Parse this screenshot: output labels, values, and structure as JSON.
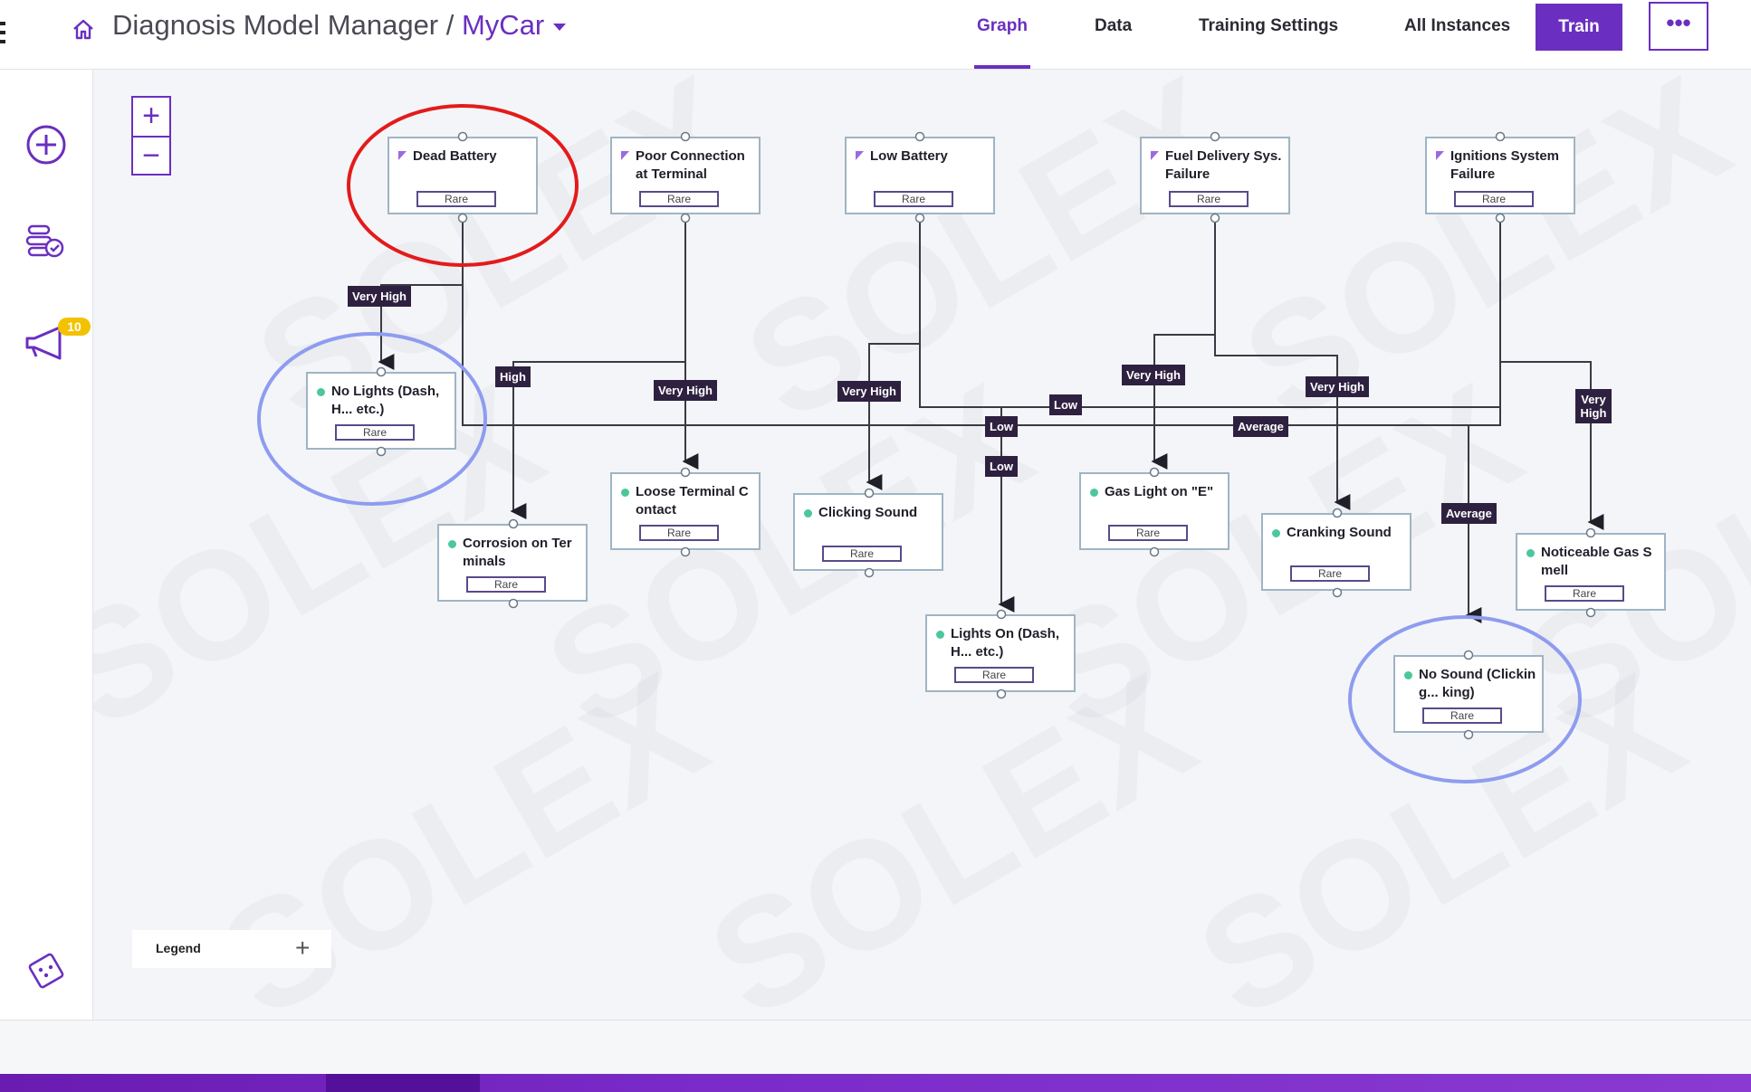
{
  "header": {
    "breadcrumb_root": "Diagnosis Model Manager /",
    "project": "MyCar",
    "tabs": [
      {
        "label": "Graph",
        "active": true
      },
      {
        "label": "Data",
        "active": false
      },
      {
        "label": "Training Settings",
        "active": false
      },
      {
        "label": "All Instances",
        "active": false
      }
    ],
    "train_label": "Train",
    "more_label": "•••"
  },
  "sidebar": {
    "icons": [
      "add-circle-icon",
      "model-review-icon",
      "announcement-icon",
      "dice-icon"
    ],
    "notification_count": "10"
  },
  "canvas": {
    "zoom_in": "+",
    "zoom_out": "−",
    "legend_label": "Legend",
    "legend_add": "+"
  },
  "causes": [
    {
      "id": "dead-battery",
      "line1": "Dead Battery",
      "line2": "",
      "prob": "Rare"
    },
    {
      "id": "poor-connection",
      "line1": "Poor Connection",
      "line2": "at Terminal",
      "prob": "Rare"
    },
    {
      "id": "low-battery",
      "line1": "Low Battery",
      "line2": "",
      "prob": "Rare"
    },
    {
      "id": "fuel-delivery",
      "line1": "Fuel Delivery Sys.",
      "line2": "Failure",
      "prob": "Rare"
    },
    {
      "id": "ignitions-system",
      "line1": "Ignitions System",
      "line2": "Failure",
      "prob": "Rare"
    }
  ],
  "symptoms": [
    {
      "id": "no-lights",
      "line1": "No Lights (Dash,",
      "line2": "H... etc.)",
      "prob": "Rare"
    },
    {
      "id": "corrosion",
      "line1": "Corrosion on Ter",
      "line2": "minals",
      "prob": "Rare"
    },
    {
      "id": "loose-terminal",
      "line1": "Loose Terminal C",
      "line2": "ontact",
      "prob": "Rare"
    },
    {
      "id": "clicking-sound",
      "line1": "Clicking Sound",
      "line2": "",
      "prob": "Rare"
    },
    {
      "id": "lights-on",
      "line1": "Lights On (Dash,",
      "line2": "H... etc.)",
      "prob": "Rare"
    },
    {
      "id": "gas-light",
      "line1": "Gas Light on \"E\"",
      "line2": "",
      "prob": "Rare"
    },
    {
      "id": "cranking-sound",
      "line1": "Cranking Sound",
      "line2": "",
      "prob": "Rare"
    },
    {
      "id": "no-sound",
      "line1": "No Sound (Clickin",
      "line2": "g... king)",
      "prob": "Rare"
    },
    {
      "id": "gas-smell",
      "line1": "Noticeable Gas S",
      "line2": "mell",
      "prob": "Rare"
    }
  ],
  "edge_labels": [
    {
      "id": "e1",
      "text": "Very High"
    },
    {
      "id": "e2",
      "text": "High"
    },
    {
      "id": "e3",
      "text": "Very High"
    },
    {
      "id": "e4",
      "text": "Very High"
    },
    {
      "id": "e5",
      "text": "Low"
    },
    {
      "id": "e6",
      "text": "Low"
    },
    {
      "id": "e7",
      "text": "Low"
    },
    {
      "id": "e8",
      "text": "Very High"
    },
    {
      "id": "e9",
      "text": "Average"
    },
    {
      "id": "e10",
      "text": "Very High"
    },
    {
      "id": "e11",
      "text": "Average"
    },
    {
      "id": "e12",
      "text": "Very High"
    }
  ],
  "watermark": "SOLEX",
  "annotations": {
    "red_circle_color": "#e31b1b",
    "blue_circle_color": "#8e9cf0"
  },
  "accent_color": "#6a2fc0"
}
